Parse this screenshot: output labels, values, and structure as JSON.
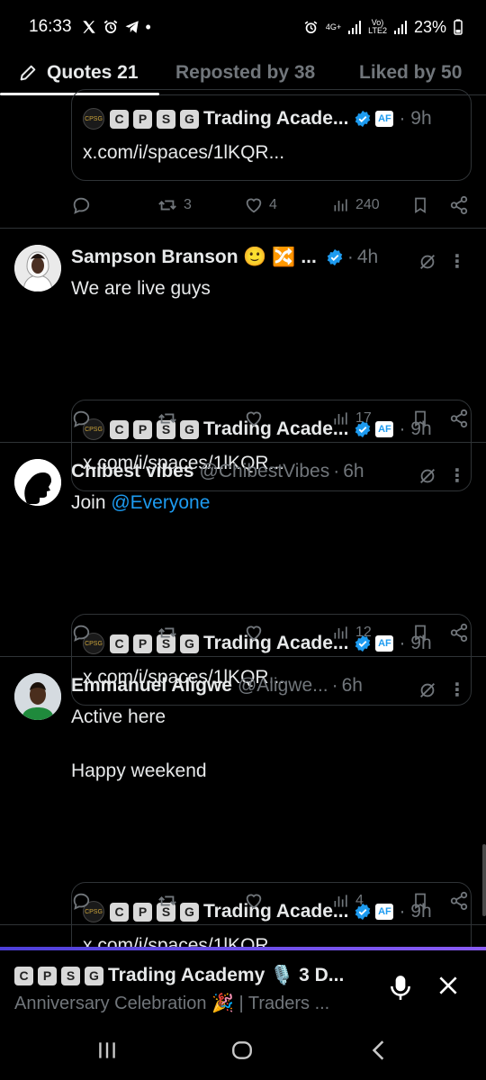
{
  "status_bar": {
    "time": "16:33",
    "left_icons": [
      "x-logo-icon",
      "alarm-icon",
      "telegram-icon",
      "dot-icon"
    ],
    "network_4g": "4G+",
    "network_volte": "Vo)",
    "network_lte": "LTE2",
    "battery": "23%"
  },
  "tabs": [
    {
      "label": "Quotes 21",
      "active": true
    },
    {
      "label": "Reposted by 38",
      "active": false
    },
    {
      "label": "Liked by 50",
      "active": false
    }
  ],
  "quoted": {
    "keys": [
      "C",
      "P",
      "S",
      "G"
    ],
    "name": "Trading Acade...",
    "af_badge": "AF",
    "time": "9h",
    "link": "x.com/i/spaces/1lKQR..."
  },
  "posts": [
    {
      "partial": true,
      "actions": {
        "reply": "",
        "repost": "3",
        "like": "4",
        "views": "240"
      }
    },
    {
      "name": "Sampson Branson 🙂 🔀 ...",
      "handle": "",
      "time": "4h",
      "text": "We are live guys",
      "actions": {
        "reply": "",
        "repost": "",
        "like": "",
        "views": "17"
      }
    },
    {
      "name": "Chibest vibes",
      "handle": "@ChibestVibes",
      "time": "6h",
      "text_prefix": "Join ",
      "mention": "@Everyone",
      "actions": {
        "reply": "",
        "repost": "",
        "like": "",
        "views": "12"
      }
    },
    {
      "name": "Emmanuel Aligwe",
      "handle": "@Aligwe...",
      "time": "6h",
      "text": "Active here\n\nHappy weekend",
      "actions": {
        "reply": "",
        "repost": "",
        "like": "",
        "views": "4"
      }
    }
  ],
  "space": {
    "keys": [
      "C",
      "P",
      "S",
      "G"
    ],
    "title": "Trading Academy 🎙️ 3 D...",
    "subtitle": "Anniversary Celebration 🎉 | Traders ..."
  },
  "colors": {
    "background": "#000000",
    "text": "#e7e9ea",
    "muted": "#71767b",
    "accent": "#1d9bf0",
    "divider": "#2f3336",
    "space_bar": "#6a4cf0"
  }
}
